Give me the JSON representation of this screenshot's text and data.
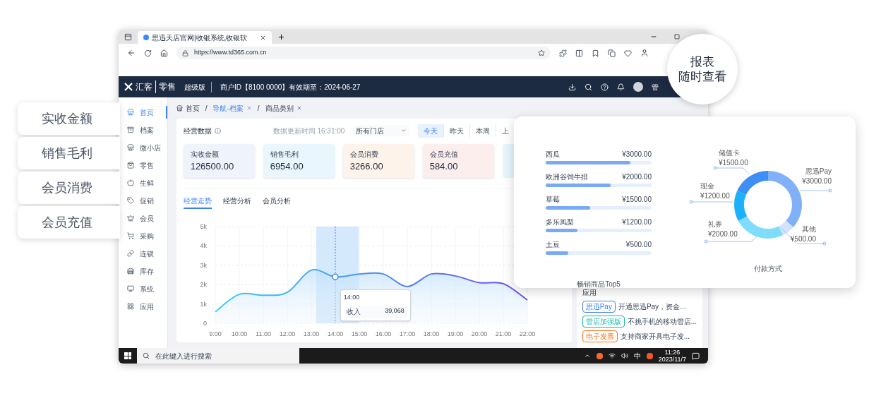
{
  "callouts": [
    "实收金额",
    "销售毛利",
    "会员消费",
    "会员充值"
  ],
  "browser": {
    "tab_title": "思迅天店官网|收银系统,收银软",
    "url": "https://www.td365.com.cn"
  },
  "header": {
    "logo_mark": "汇客",
    "logo_product": "零售",
    "edition": "超级版",
    "merchant": "商户ID【8100 0000】有效期至：2024-06-27",
    "user": "管"
  },
  "sidebar": [
    {
      "label": "首页",
      "selected": true
    },
    {
      "label": "档案",
      "selected": false
    },
    {
      "label": "微小店",
      "selected": false
    },
    {
      "label": "零售",
      "selected": false
    },
    {
      "label": "生鲜",
      "selected": false
    },
    {
      "label": "促销",
      "selected": false
    },
    {
      "label": "会员",
      "selected": false
    },
    {
      "label": "采购",
      "selected": false
    },
    {
      "label": "连锁",
      "selected": false
    },
    {
      "label": "库存",
      "selected": false
    },
    {
      "label": "系统",
      "selected": false
    },
    {
      "label": "应用",
      "selected": false
    }
  ],
  "breadcrumbs": {
    "separator": "/",
    "items": [
      {
        "label": "首页",
        "selected": false,
        "closable": false
      },
      {
        "label": "导航-档案",
        "selected": true,
        "closable": true
      },
      {
        "label": "商品类别",
        "selected": false,
        "closable": true
      }
    ]
  },
  "section": {
    "title": "经营数据",
    "updated": "数据更新时间 16:31:00",
    "store_select": "所有门店",
    "ranges": [
      {
        "label": "今天",
        "selected": true
      },
      {
        "label": "昨天",
        "selected": false
      },
      {
        "label": "本周",
        "selected": false
      },
      {
        "label": "上",
        "selected": false
      }
    ]
  },
  "stats": [
    {
      "label": "实收金额",
      "value": "126500.00",
      "color": "#eef3fc"
    },
    {
      "label": "销售毛利",
      "value": "6954.00",
      "color": "#e9f6fd"
    },
    {
      "label": "会员消费",
      "value": "3266.00",
      "color": "#fdf3ea"
    },
    {
      "label": "会员充值",
      "value": "584.00",
      "color": "#fdeeee"
    }
  ],
  "trend_tabs": [
    {
      "label": "经营走势",
      "selected": true
    },
    {
      "label": "经营分析",
      "selected": false
    },
    {
      "label": "会员分析",
      "selected": false
    }
  ],
  "trend": {
    "tooltip": {
      "time": "14:00",
      "value": "39,068"
    },
    "chart_data": {
      "type": "area",
      "grid": true,
      "categories": [
        "9:00",
        "10:00",
        "11:00",
        "12:00",
        "13:00",
        "14:00",
        "15:00",
        "16:00",
        "17:00",
        "18:00",
        "19:00",
        "20:00",
        "21:00",
        "22:00"
      ],
      "series": [
        {
          "name": "收入",
          "color": "#2fd3f7",
          "values": [
            0.6,
            1.5,
            1.45,
            1.6,
            2.75,
            2.4,
            2.55,
            2.55,
            1.9,
            2.55,
            2.45,
            2.1,
            2.05,
            1.2
          ]
        }
      ],
      "ylim": [
        0,
        5
      ],
      "ref_lines": [
        {
          "axis": "x",
          "value": "14:00"
        }
      ],
      "yticks": [
        {
          "value": 0,
          "label": "0"
        },
        {
          "value": 1,
          "label": "1k"
        },
        {
          "value": 2,
          "label": "2k"
        },
        {
          "value": 3,
          "label": "3k"
        },
        {
          "value": 4,
          "label": "4k"
        },
        {
          "value": 5,
          "label": "5k"
        }
      ]
    }
  },
  "apps": {
    "title": "应用",
    "items": [
      {
        "tag": "思迅Pay",
        "desc": "开通思迅Pay，资金...",
        "color": "#3b82f6"
      },
      {
        "tag": "管店加强版",
        "desc": "不挑手机的移动管店...",
        "color": "#14b8a6"
      },
      {
        "tag": "电子发票",
        "desc": "支持商家开具电子发...",
        "color": "#f97316"
      }
    ]
  },
  "taskbar": {
    "search_placeholder": "在此键入进行搜索",
    "ime": "中",
    "time": "11:26",
    "date": "2023/11/7"
  },
  "bubble": {
    "lines": [
      "报表",
      "随时查看"
    ]
  },
  "popup": {
    "top_products": {
      "title": "畅销商品Top5",
      "items": [
        {
          "name": "西瓜",
          "amount": "¥3000.00",
          "level": 0.8
        },
        {
          "name": "欧洲谷饲牛排",
          "amount": "¥2000.00",
          "level": 0.61
        },
        {
          "name": "草莓",
          "amount": "¥1500.00",
          "level": 0.42
        },
        {
          "name": "多乐凤梨",
          "amount": "¥1200.00",
          "level": 0.3
        },
        {
          "name": "土豆",
          "amount": "¥500.00",
          "level": 0.21
        }
      ]
    },
    "payments": {
      "title": "付款方式",
      "chart_data": {
        "type": "donut",
        "categories": [
          "思迅Pay",
          "其他",
          "礼券",
          "现金",
          "储值卡"
        ],
        "values": [
          3000,
          500,
          2000,
          1200,
          1500
        ],
        "value_labels": [
          "¥3000.00",
          "¥500.00",
          "¥2000.00",
          "¥1200.00",
          "¥1500.00"
        ],
        "colors": [
          "#7fb0f8",
          "#d3e3fb",
          "#7fdcfd",
          "#1bb1fb",
          "#3d8ef5"
        ]
      }
    }
  }
}
